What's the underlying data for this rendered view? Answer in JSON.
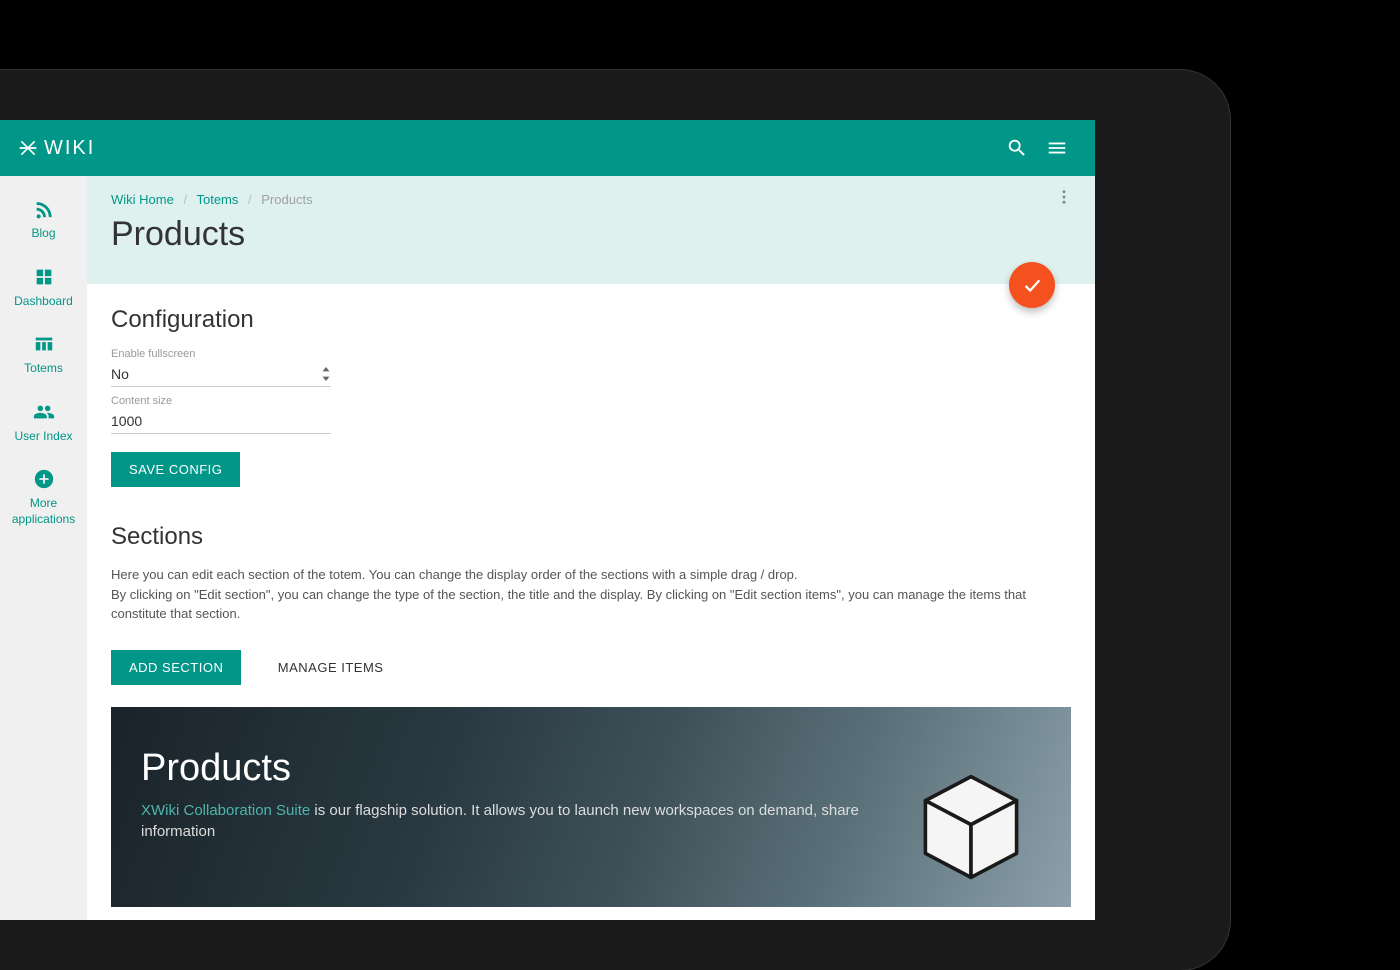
{
  "brand": {
    "name": "WIKI"
  },
  "sidebar": {
    "items": [
      {
        "label": "Blog"
      },
      {
        "label": "Dashboard"
      },
      {
        "label": "Totems"
      },
      {
        "label": "User Index"
      },
      {
        "label": "More applications"
      }
    ]
  },
  "breadcrumb": {
    "home": "Wiki Home",
    "parent": "Totems",
    "current": "Products"
  },
  "page": {
    "title": "Products"
  },
  "config": {
    "heading": "Configuration",
    "fullscreen_label": "Enable fullscreen",
    "fullscreen_value": "No",
    "size_label": "Content size",
    "size_value": "1000",
    "save_label": "SAVE CONFIG"
  },
  "sections": {
    "heading": "Sections",
    "help1": "Here you can edit each section of the totem. You can change the display order of the sections with a simple drag / drop.",
    "help2": "By clicking on \"Edit section\", you can change the type of the section, the title and the display. By clicking on \"Edit section items\", you can manage the items that constitute that section.",
    "add_label": "ADD SECTION",
    "manage_label": "MANAGE ITEMS"
  },
  "preview": {
    "title": "Products",
    "highlight": "XWiki Collaboration Suite",
    "body_rest": " is our flagship solution. It allows you to launch new workspaces on demand, share information"
  }
}
